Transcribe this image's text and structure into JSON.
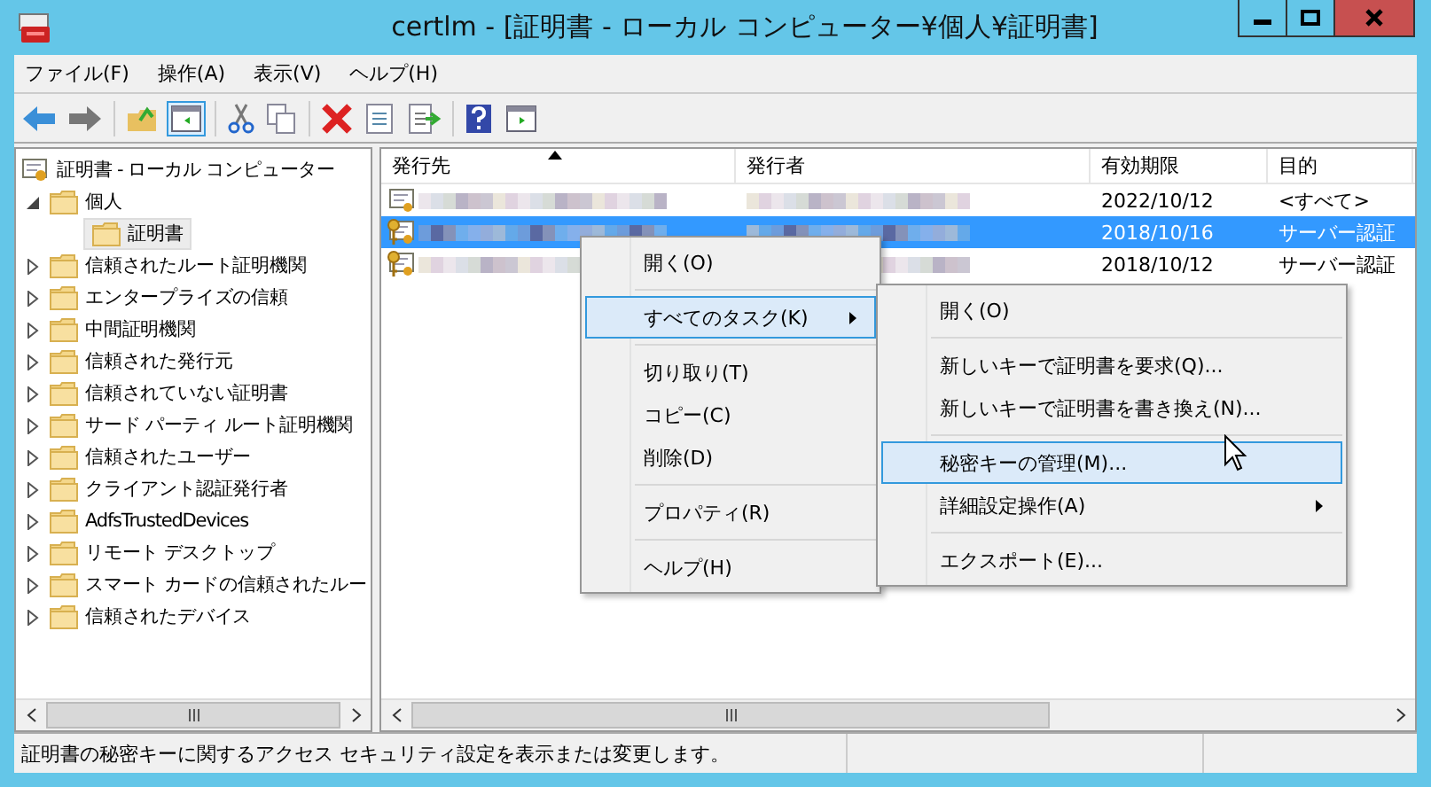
{
  "window": {
    "title": "certlm - [証明書 - ローカル コンピューター¥個人¥証明書]"
  },
  "menu_bar": [
    "ファイル(F)",
    "操作(A)",
    "表示(V)",
    "ヘルプ(H)"
  ],
  "tree": {
    "label": "証明書 - ローカル コンピューター",
    "children": [
      {
        "label": "個人",
        "expanded": true,
        "children": [
          {
            "label": "証明書",
            "selected": true
          }
        ]
      },
      {
        "label": "信頼されたルート証明機関",
        "expanded": false
      },
      {
        "label": "エンタープライズの信頼",
        "expanded": false
      },
      {
        "label": "中間証明機関",
        "expanded": false
      },
      {
        "label": "信頼された発行元",
        "expanded": false
      },
      {
        "label": "信頼されていない証明書",
        "expanded": false
      },
      {
        "label": "サード パーティ ルート証明機関",
        "expanded": false
      },
      {
        "label": "信頼されたユーザー",
        "expanded": false
      },
      {
        "label": "クライアント認証発行者",
        "expanded": false
      },
      {
        "label": "AdfsTrustedDevices",
        "expanded": false
      },
      {
        "label": "リモート デスクトップ",
        "expanded": false
      },
      {
        "label": "スマート カードの信頼されたルー",
        "expanded": false
      },
      {
        "label": "信頼されたデバイス",
        "expanded": false
      }
    ]
  },
  "table": {
    "columns": [
      {
        "label": "発行先",
        "sorted": true
      },
      {
        "label": "発行者",
        "sorted": false
      },
      {
        "label": "有効期限",
        "sorted": false
      },
      {
        "label": "目的",
        "sorted": false
      }
    ],
    "rows": [
      {
        "expiry": "2022/10/12",
        "purpose": "<すべて>",
        "has_key": false,
        "selected": false
      },
      {
        "expiry": "2018/10/16",
        "purpose": "サーバー認証",
        "has_key": true,
        "selected": true
      },
      {
        "expiry": "2018/10/12",
        "purpose": "サーバー認証",
        "has_key": true,
        "selected": false
      }
    ]
  },
  "context_menu": [
    {
      "kind": "item",
      "label": "開く(O)",
      "selected": false,
      "submenu": false
    },
    {
      "kind": "separator"
    },
    {
      "kind": "item",
      "label": "すべてのタスク(K)",
      "selected": true,
      "submenu": true
    },
    {
      "kind": "separator"
    },
    {
      "kind": "item",
      "label": "切り取り(T)",
      "selected": false,
      "submenu": false
    },
    {
      "kind": "item",
      "label": "コピー(C)",
      "selected": false,
      "submenu": false
    },
    {
      "kind": "item",
      "label": "削除(D)",
      "selected": false,
      "submenu": false
    },
    {
      "kind": "separator"
    },
    {
      "kind": "item",
      "label": "プロパティ(R)",
      "selected": false,
      "submenu": false
    },
    {
      "kind": "separator"
    },
    {
      "kind": "item",
      "label": "ヘルプ(H)",
      "selected": false,
      "submenu": false
    }
  ],
  "submenu": [
    {
      "kind": "item",
      "label": "開く(O)",
      "selected": false,
      "submenu": false
    },
    {
      "kind": "separator"
    },
    {
      "kind": "item",
      "label": "新しいキーで証明書を要求(Q)...",
      "selected": false,
      "submenu": false
    },
    {
      "kind": "item",
      "label": "新しいキーで証明書を書き換え(N)...",
      "selected": false,
      "submenu": false
    },
    {
      "kind": "separator"
    },
    {
      "kind": "item",
      "label": "秘密キーの管理(M)...",
      "selected": true,
      "submenu": false
    },
    {
      "kind": "item",
      "label": "詳細設定操作(A)",
      "selected": false,
      "submenu": true
    },
    {
      "kind": "separator"
    },
    {
      "kind": "item",
      "label": "エクスポート(E)...",
      "selected": false,
      "submenu": false
    }
  ],
  "status_bar": "証明書の秘密キーに関するアクセス セキュリティ設定を表示または変更します。"
}
